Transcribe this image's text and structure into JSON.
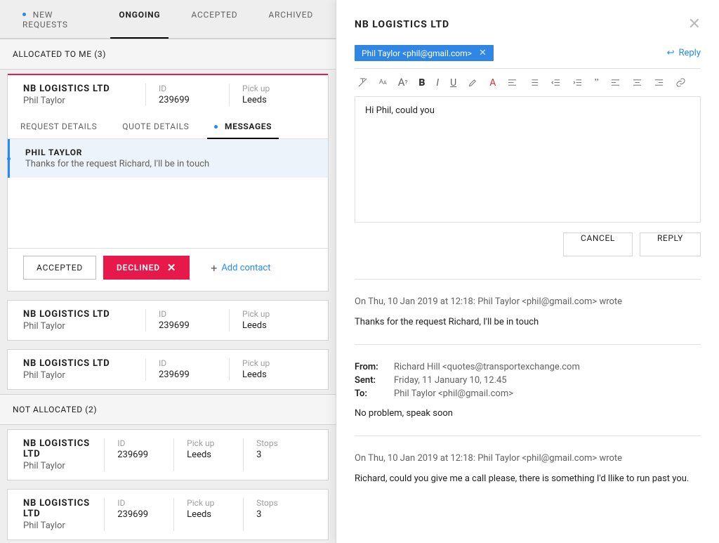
{
  "tabs": {
    "new_requests": "NEW REQUESTS",
    "ongoing": "ONGOING",
    "accepted": "ACCEPTED",
    "archived": "ARCHIVED"
  },
  "sections": {
    "allocated": "ALLOCATED TO ME (3)",
    "not_allocated": "NOT ALLOCATED (2)"
  },
  "labels": {
    "id": "ID",
    "pickup": "Pick up",
    "stops": "Stops"
  },
  "card_selected": {
    "title": "NB LOGISTICS LTD",
    "name": "Phil Taylor",
    "id": "239699",
    "pickup": "Leeds",
    "subtabs": {
      "request": "REQUEST DETAILS",
      "quote": "QUOTE DETAILS",
      "messages": "MESSAGES"
    },
    "message": {
      "from": "PHIL TAYLOR",
      "body": "Thanks for the request Richard, I'll be in touch"
    },
    "actions": {
      "accepted": "ACCEPTED",
      "declined": "DECLINED",
      "add_contact": "Add contact"
    }
  },
  "cards_small": [
    {
      "title": "NB LOGISTICS LTD",
      "name": "Phil Taylor",
      "id": "239699",
      "pickup": "Leeds"
    },
    {
      "title": "NB LOGISTICS LTD",
      "name": "Phil Taylor",
      "id": "239699",
      "pickup": "Leeds"
    }
  ],
  "cards_unalloc": [
    {
      "title": "NB LOGISTICS LTD",
      "name": "Phil Taylor",
      "id": "239699",
      "pickup": "Leeds",
      "stops": "3"
    },
    {
      "title": "NB LOGISTICS LTD",
      "name": "Phil Taylor",
      "id": "239699",
      "pickup": "Leeds",
      "stops": "3"
    }
  ],
  "right": {
    "title": "NB LOGISTICS LTD",
    "chip": "Phil Taylor <phil@gmail.com>",
    "reply": "Reply",
    "editor_text": "Hi Phil, could you",
    "buttons": {
      "cancel": "CANCEL",
      "reply": "REPLY"
    },
    "q1": "On Thu, 10 Jan 2019 at 12:18: Phil Taylor <phil@gmail.com> wrote",
    "body1": "Thanks for the request Richard, I'll be in touch",
    "meta": {
      "from_k": "From:",
      "from_v": "Richard Hill <quotes@transportexchange.com",
      "sent_k": "Sent:",
      "sent_v": "Friday, 11 January 10, 12.45",
      "to_k": "To:",
      "to_v": "Phil Taylor <phil@gmail.com>"
    },
    "body2": "No problem, speak soon",
    "q2": "On Thu, 10 Jan 2019 at 12:18: Phil Taylor <phil@gmail.com> wrote",
    "body3": "Richard, could you give me a call please, there is something I'd llike to run past you."
  }
}
